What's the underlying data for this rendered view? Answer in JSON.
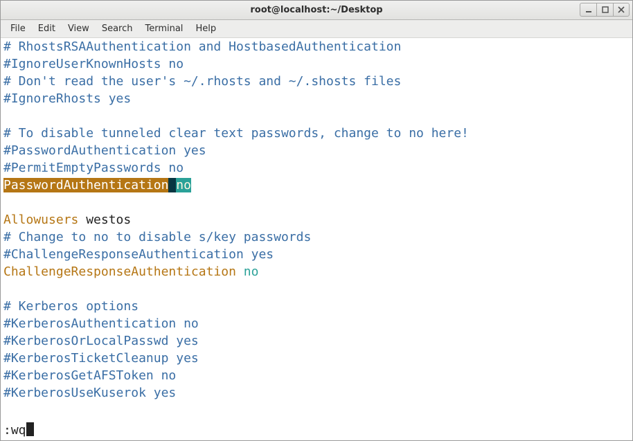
{
  "window": {
    "title": "root@localhost:~/Desktop"
  },
  "menu": {
    "file": "File",
    "edit": "Edit",
    "view": "View",
    "search": "Search",
    "terminal": "Terminal",
    "help": "Help"
  },
  "lines": {
    "l01": "# RhostsRSAAuthentication and HostbasedAuthentication",
    "l02": "#IgnoreUserKnownHosts no",
    "l03": "# Don't read the user's ~/.rhosts and ~/.shosts files",
    "l04": "#IgnoreRhosts yes",
    "l05": "",
    "l06": "# To disable tunneled clear text passwords, change to no here!",
    "l07": "#PasswordAuthentication yes",
    "l08": "#PermitEmptyPasswords no",
    "l09_key": "PasswordAuthentication",
    "l09_sp": " ",
    "l09_val": "no",
    "l10": "",
    "l11_key": "Allowusers",
    "l11_rest": " westos",
    "l12": "# Change to no to disable s/key passwords",
    "l13": "#ChallengeResponseAuthentication yes",
    "l14_key": "ChallengeResponseAuthentication",
    "l14_sp": " ",
    "l14_val": "no",
    "l15": "",
    "l16": "# Kerberos options",
    "l17": "#KerberosAuthentication no",
    "l18": "#KerberosOrLocalPasswd yes",
    "l19": "#KerberosTicketCleanup yes",
    "l20": "#KerberosGetAFSToken no",
    "l21": "#KerberosUseKuserok yes"
  },
  "cmd": {
    "text": ":wq"
  }
}
